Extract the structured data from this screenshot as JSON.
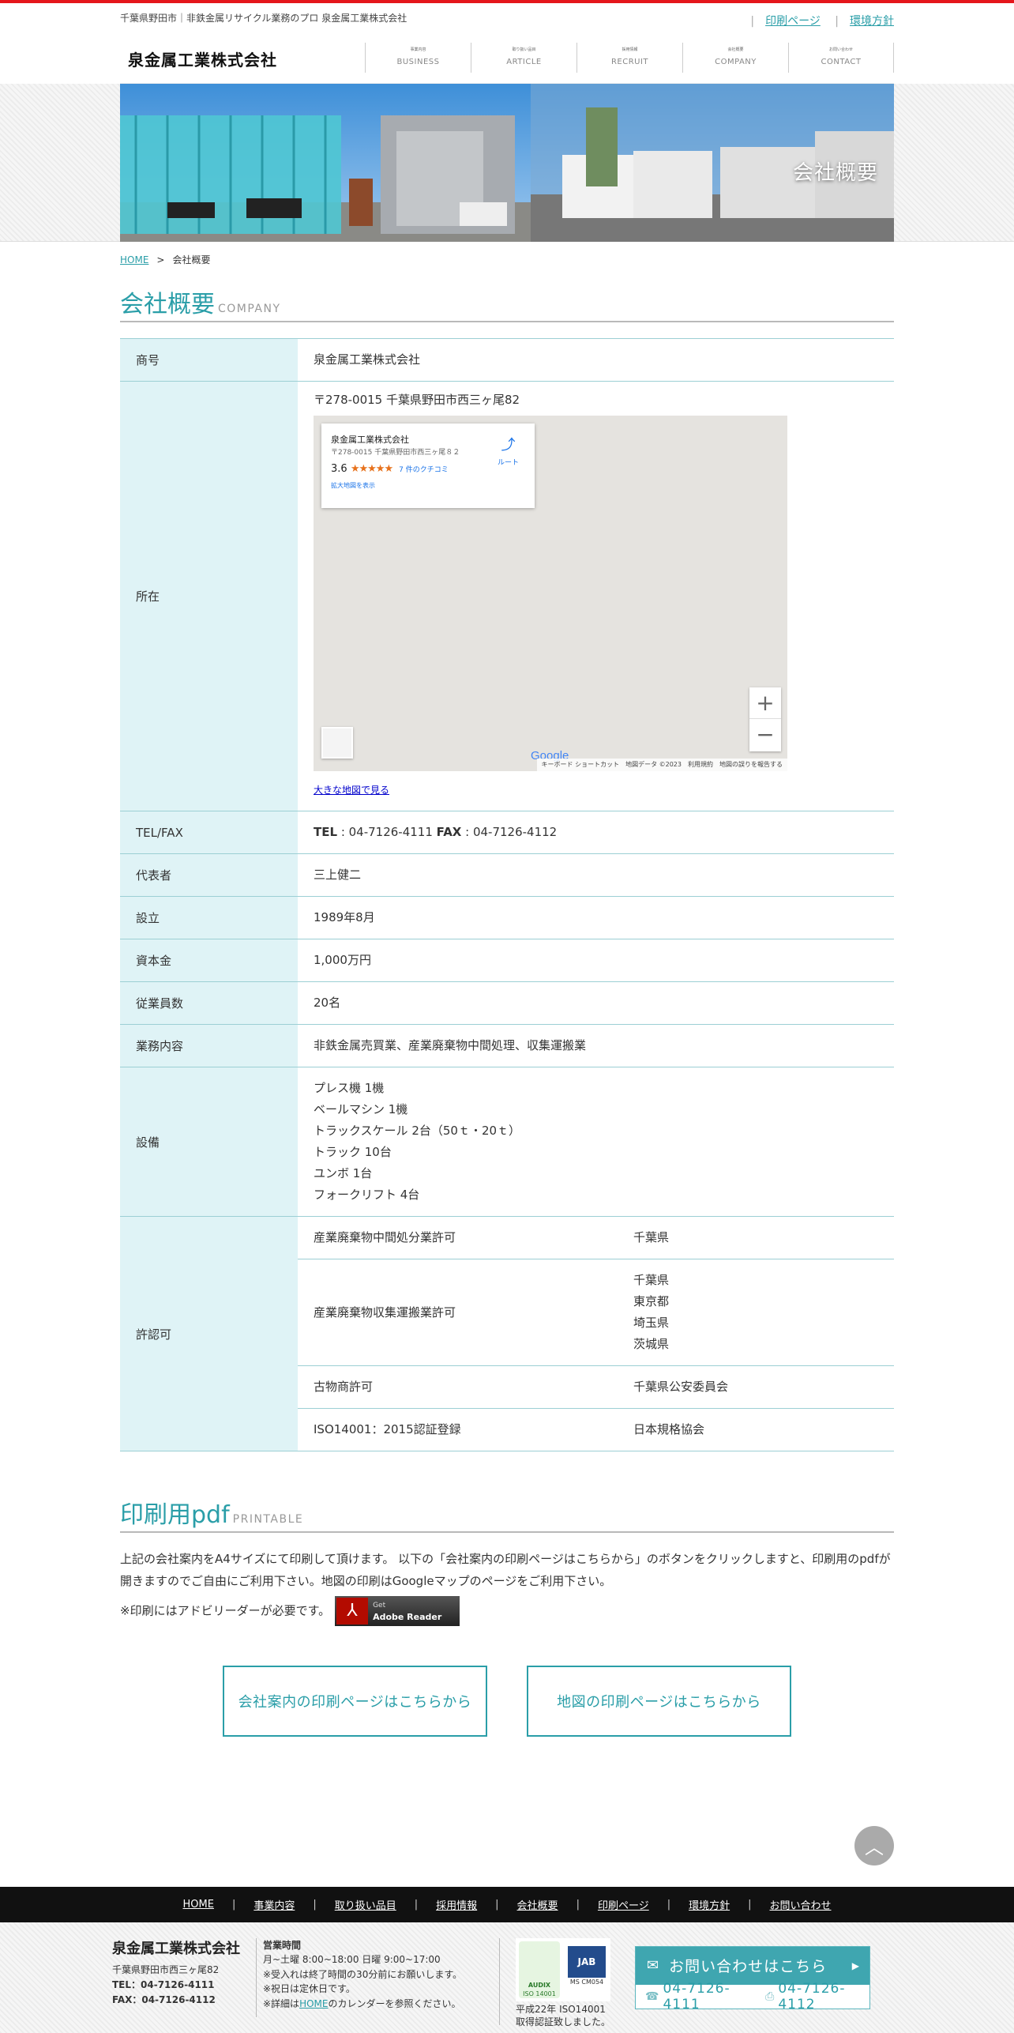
{
  "header": {
    "tagline": "千葉県野田市｜非鉄金属リサイクル業務のプロ 泉金属工業株式会社",
    "top_links": [
      "印刷ページ",
      "環境方針"
    ],
    "logo": "泉金属工業株式会社",
    "nav": [
      {
        "mini": "事業内容",
        "label": "BUSINESS"
      },
      {
        "mini": "取り扱い品目",
        "label": "ARTICLE"
      },
      {
        "mini": "採用情報",
        "label": "RECRUIT"
      },
      {
        "mini": "会社概要",
        "label": "COMPANY"
      },
      {
        "mini": "お問い合わせ",
        "label": "CONTACT"
      }
    ]
  },
  "hero": {
    "title": "会社概要"
  },
  "breadcrumb": {
    "home": "HOME",
    "sep": ">",
    "current": "会社概要"
  },
  "company": {
    "heading": "会社概要",
    "heading_en": "COMPANY",
    "rows": {
      "name": {
        "label": "商号",
        "value": "泉金属工業株式会社"
      },
      "address": {
        "label": "所在",
        "value": "〒278-0015 千葉県野田市西三ヶ尾82"
      },
      "tel": {
        "label": "TEL/FAX",
        "tel_label": "TEL",
        "tel": " : 04-7126-4111 ",
        "fax_label": "FAX",
        "fax": " : 04-7126-4112"
      },
      "rep": {
        "label": "代表者",
        "value": "三上健二"
      },
      "founded": {
        "label": "設立",
        "value": "1989年8月"
      },
      "capital": {
        "label": "資本金",
        "value": "1,000万円"
      },
      "employees": {
        "label": "従業員数",
        "value": "20名"
      },
      "business": {
        "label": "業務内容",
        "value": "非鉄金属売買業、産業廃棄物中間処理、収集運搬業"
      },
      "equipment": {
        "label": "設備",
        "items": [
          "プレス機 1機",
          "ベールマシン 1機",
          "トラックスケール 2台（50ｔ・20ｔ）",
          "トラック 10台",
          "ユンボ 1台",
          "フォークリフト 4台"
        ]
      },
      "permits": {
        "label": "許認可",
        "items": [
          {
            "name": "産業廃棄物中間処分業許可",
            "authority": [
              "千葉県"
            ]
          },
          {
            "name": "産業廃棄物収集運搬業許可",
            "authority": [
              "千葉県",
              "東京都",
              "埼玉県",
              "茨城県"
            ]
          },
          {
            "name": "古物商許可",
            "authority": [
              "千葉県公安委員会"
            ]
          },
          {
            "name": "ISO14001：2015認証登録",
            "authority": [
              "日本規格協会"
            ]
          }
        ]
      }
    },
    "map": {
      "place_name": "泉金属工業株式会社",
      "place_addr": "〒278-0015 千葉県野田市西三ヶ尾８２",
      "rating": "3.6",
      "stars": "★★★★★",
      "reviews": "7 件のクチコミ",
      "more": "拡大地図を表示",
      "directions": "ルート",
      "zoom_in": "+",
      "zoom_out": "−",
      "google": "Google",
      "footer": "キーボード ショートカット　地図データ ©2023　利用規約　地図の誤りを報告する",
      "large_link": "大きな地図で見る"
    }
  },
  "print": {
    "heading": "印刷用pdf",
    "heading_en": "PRINTABLE",
    "text": "上記の会社案内をA4サイズにて印刷して頂けます。 以下の「会社案内の印刷ページはこちらから」のボタンをクリックしますと、印刷用のpdfが開きますのでご自由にご利用下さい。地図の印刷はGoogleマップのページをご利用下さい。",
    "note": "※印刷にはアドビリーダーが必要です。",
    "adobe_get": "Get",
    "adobe_name": "Adobe Reader",
    "buttons": [
      "会社案内の印刷ページはこちらから",
      "地図の印刷ページはこちらから"
    ]
  },
  "totop": "︿",
  "footer_nav": [
    "HOME",
    "事業内容",
    "取り扱い品目",
    "採用情報",
    "会社概要",
    "印刷ページ",
    "環境方針",
    "お問い合わせ"
  ],
  "footer": {
    "company": "泉金属工業株式会社",
    "address": "千葉県野田市西三ヶ尾82",
    "tel": "TEL：04-7126-4111",
    "fax": "FAX：04-7126-4112",
    "hours_title": "営業時間",
    "hours": "月~土曜 8:00~18:00 日曜 9:00~17:00",
    "note1": "※受入れは終了時間の30分前にお願いします。",
    "note2": "※祝日は定休日です。",
    "note3_a": "※詳細は",
    "note3_link": "HOME",
    "note3_b": "のカレンダーを参照ください。",
    "iso_audix": "AUDIX",
    "iso_a": "ISO 14001",
    "iso_jab": "JAB",
    "iso_j": "MS CM054",
    "iso_text1": "平成22年 ISO14001",
    "iso_text2": "取得認証致しました。",
    "cta_label": "お問い合わせはこちら",
    "cta_tel": "04-7126-4111",
    "cta_fax": "04-7126-4112"
  },
  "colors": {
    "accent": "#2a9ea8",
    "table_head": "#dff3f6",
    "top_line": "#e5161c"
  }
}
